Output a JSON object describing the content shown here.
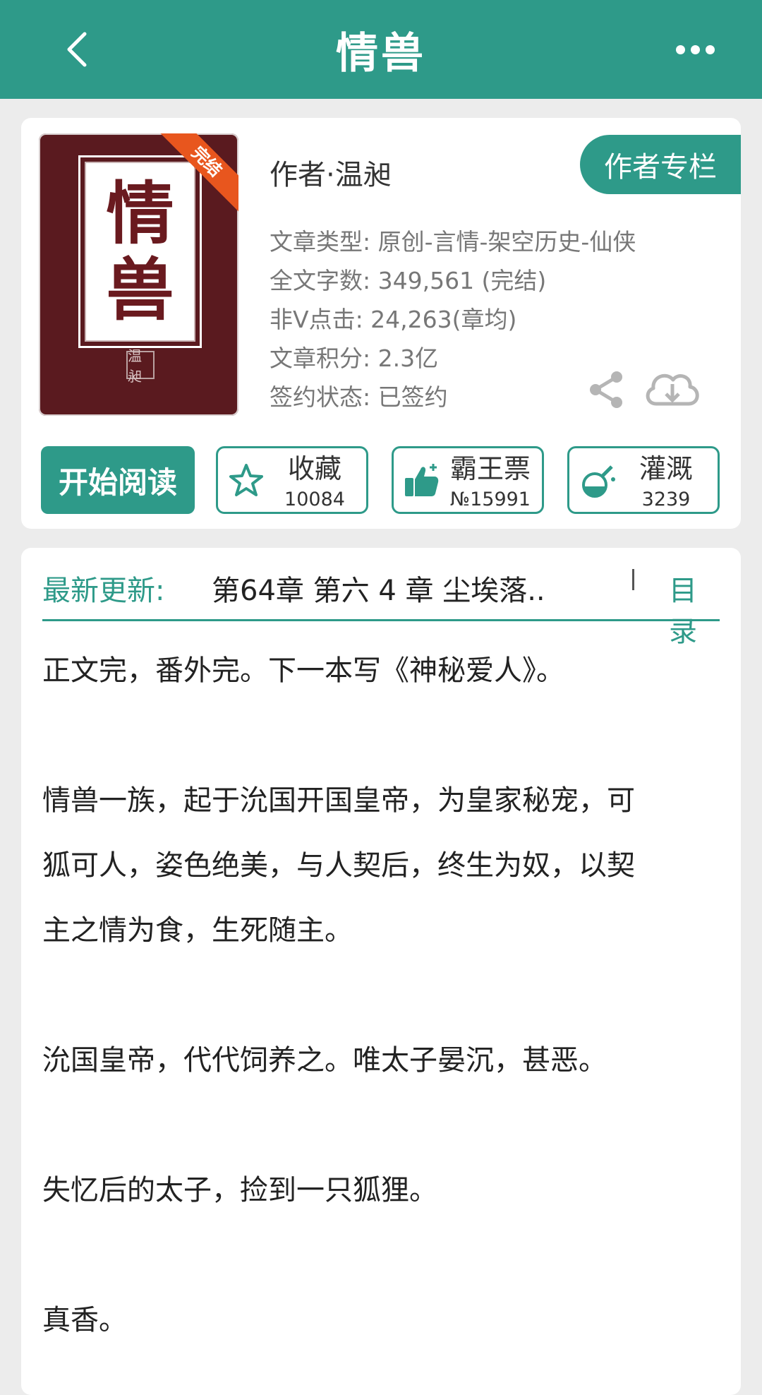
{
  "header": {
    "title": "情兽"
  },
  "book": {
    "cover_title_char1": "情",
    "cover_title_char2": "兽",
    "cover_badge": "完结",
    "cover_seal": "温昶",
    "author": "作者·温昶",
    "author_column_label": "作者专栏",
    "meta": [
      "文章类型: 原创-言情-架空历史-仙侠",
      "全文字数: 349,561 (完结)",
      "非V点击: 24,263(章均)",
      "文章积分: 2.3亿",
      "签约状态:  已签约"
    ]
  },
  "actions": {
    "read_label": "开始阅读",
    "favorite": {
      "label": "收藏",
      "count": "10084"
    },
    "vote": {
      "label": "霸王票",
      "count": "№15991"
    },
    "nutrient": {
      "label": "灌溉",
      "count": "3239"
    }
  },
  "latest": {
    "label": "最新更新:",
    "chapter": "第64章  第六 4 章 尘埃落..",
    "toc_label": "目录"
  },
  "description": [
    "正文完，番外完。下一本写《神秘爱人》。",
    "",
    "情兽一族，起于沇国开国皇帝，为皇家秘宠，可",
    "狐可人，姿色绝美，与人契后，终生为奴，以契",
    "主之情为食，生死随主。",
    "",
    "沇国皇帝，代代饲养之。唯太子晏沉，甚恶。",
    "",
    "失忆后的太子，捡到一只狐狸。",
    "",
    "真香。"
  ],
  "colors": {
    "accent": "#2e9a89",
    "badge": "#e8561e",
    "cover_bg": "#5a1a1f"
  },
  "icons": [
    "back-icon",
    "more-icon",
    "share-icon",
    "download-icon",
    "star-icon",
    "thumb-up-icon",
    "flask-icon"
  ]
}
